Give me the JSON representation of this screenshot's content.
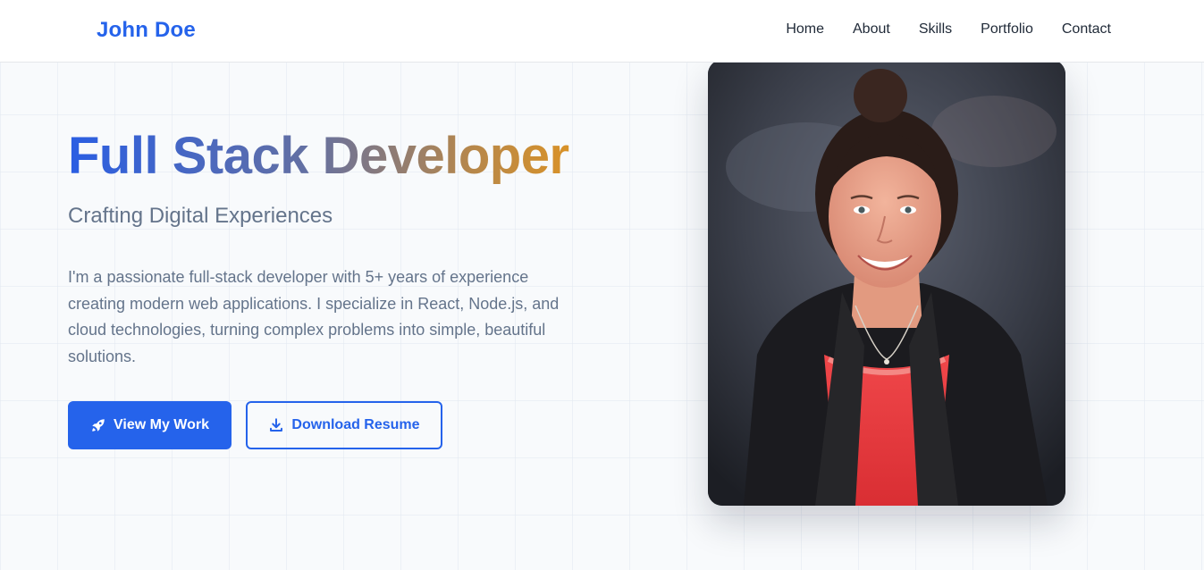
{
  "nav": {
    "brand": "John Doe",
    "links": [
      "Home",
      "About",
      "Skills",
      "Portfolio",
      "Contact"
    ]
  },
  "hero": {
    "headline": "Full Stack Developer",
    "subtitle": "Crafting Digital Experiences",
    "intro": "I'm a passionate full-stack developer with 5+ years of experience creating modern web applications. I specialize in React, Node.js, and cloud technologies, turning complex problems into simple, beautiful solutions.",
    "primary_button": {
      "label": "View My Work",
      "icon": "rocket-icon"
    },
    "secondary_button": {
      "label": "Download Resume",
      "icon": "download-icon"
    }
  },
  "colors": {
    "accent": "#2563eb",
    "headline_gradient": [
      "#2a5ee3",
      "#6470a2",
      "#b6874b",
      "#e5961c"
    ],
    "muted_text": "#64748b"
  }
}
